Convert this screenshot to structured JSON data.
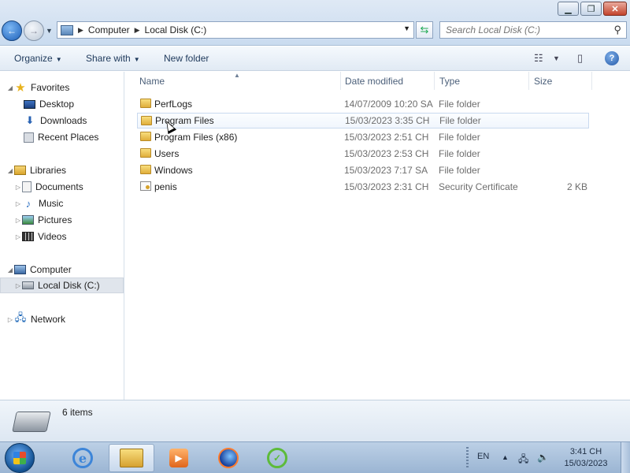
{
  "window": {
    "minimize_icon": "minimize-icon",
    "maximize_icon": "restore-icon",
    "close_icon": "close-icon"
  },
  "nav": {
    "breadcrumb": [
      "Computer",
      "Local Disk (C:)"
    ],
    "search_placeholder": "Search Local Disk (C:)"
  },
  "toolbar": {
    "organize": "Organize",
    "share_with": "Share with",
    "new_folder": "New folder"
  },
  "sidebar": {
    "favorites": {
      "label": "Favorites",
      "items": [
        "Desktop",
        "Downloads",
        "Recent Places"
      ]
    },
    "libraries": {
      "label": "Libraries",
      "items": [
        "Documents",
        "Music",
        "Pictures",
        "Videos"
      ]
    },
    "computer": {
      "label": "Computer",
      "items": [
        "Local Disk (C:)"
      ]
    },
    "network": {
      "label": "Network"
    }
  },
  "columns": {
    "name": "Name",
    "date": "Date modified",
    "type": "Type",
    "size": "Size"
  },
  "files": [
    {
      "name": "PerfLogs",
      "date": "14/07/2009 10:20 SA",
      "type": "File folder",
      "size": ""
    },
    {
      "name": "Program Files",
      "date": "15/03/2023 3:35 CH",
      "type": "File folder",
      "size": ""
    },
    {
      "name": "Program Files (x86)",
      "date": "15/03/2023 2:51 CH",
      "type": "File folder",
      "size": ""
    },
    {
      "name": "Users",
      "date": "15/03/2023 2:53 CH",
      "type": "File folder",
      "size": ""
    },
    {
      "name": "Windows",
      "date": "15/03/2023 7:17 SA",
      "type": "File folder",
      "size": ""
    },
    {
      "name": "penis",
      "date": "15/03/2023 2:31 CH",
      "type": "Security Certificate",
      "size": "2 KB"
    }
  ],
  "details": {
    "count": "6 items"
  },
  "taskbar": {
    "language": "EN",
    "time": "3:41 CH",
    "date": "15/03/2023"
  }
}
